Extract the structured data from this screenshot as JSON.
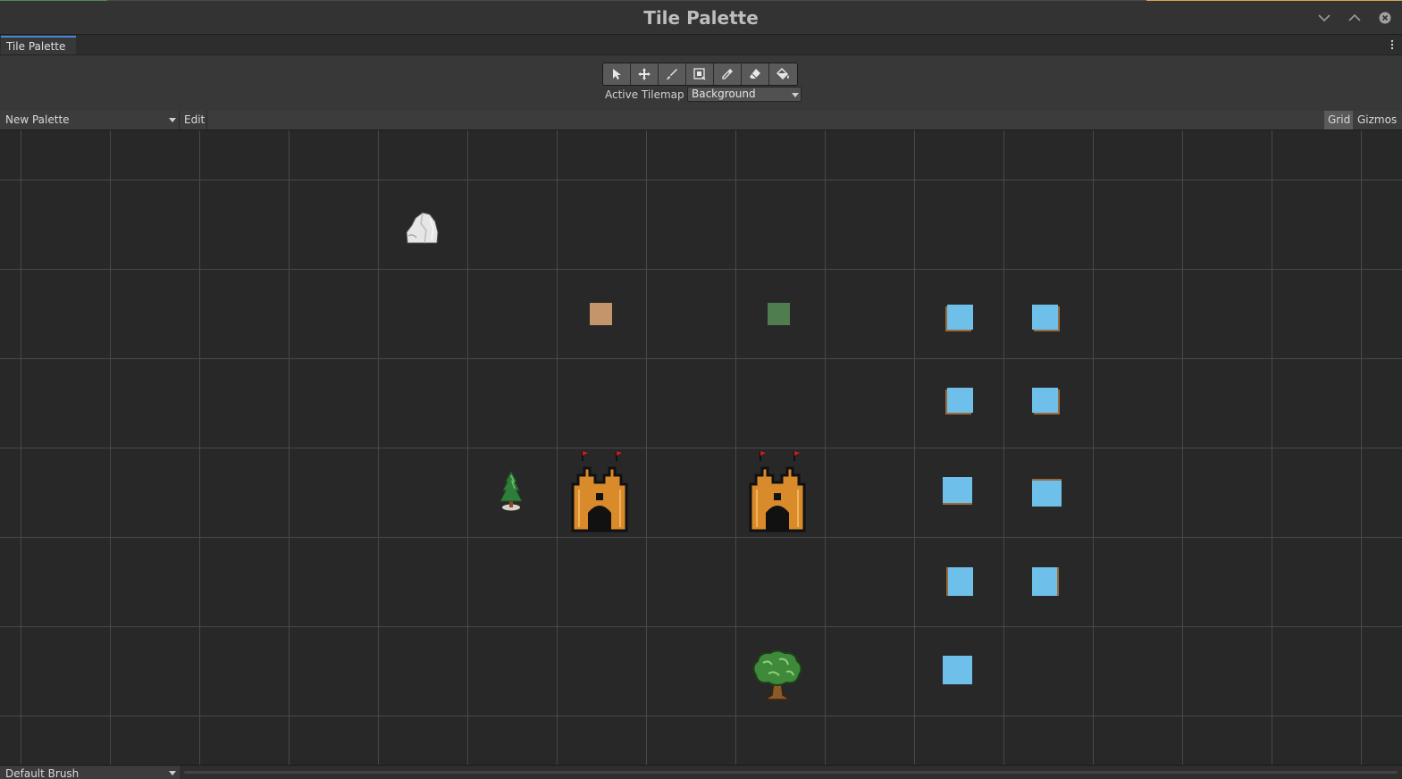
{
  "window": {
    "title": "Tile Palette",
    "controls": [
      "chevron-down-icon",
      "chevron-up-icon",
      "close-icon"
    ]
  },
  "tabs": [
    {
      "label": "Tile Palette",
      "active": true
    }
  ],
  "toolbar": {
    "tools": [
      "select-icon",
      "move-icon",
      "paint-brush-icon",
      "box-fill-icon",
      "picker-icon",
      "eraser-icon",
      "flood-fill-icon"
    ],
    "active_tilemap_label": "Active Tilemap",
    "active_tilemap_value": "Background"
  },
  "palette_bar": {
    "palette_name": "New Palette",
    "edit_label": "Edit",
    "grid_label": "Grid",
    "gizmos_label": "Gizmos"
  },
  "tiles": [
    {
      "name": "rock-tile",
      "icon": "rock-icon"
    },
    {
      "name": "brown-tile",
      "color": "#c4956a"
    },
    {
      "name": "green-tile",
      "color": "#4f7d4f"
    },
    {
      "name": "water-tile",
      "color": "#6ec0ea",
      "count": 9
    },
    {
      "name": "pine-tree-tile",
      "icon": "pine-tree-icon"
    },
    {
      "name": "castle-tile",
      "icon": "castle-icon",
      "count": 2
    },
    {
      "name": "oak-tree-tile",
      "icon": "oak-tree-icon"
    }
  ],
  "brush_bar": {
    "brush_name": "Default Brush"
  },
  "colors": {
    "canvas_bg": "#282828",
    "grid_line": "#484848",
    "tab_accent": "#4a8ad4",
    "water": "#6ec0ea",
    "dirt": "#c4956a",
    "grass": "#4f7d4f",
    "castle": "#d98a2b"
  }
}
